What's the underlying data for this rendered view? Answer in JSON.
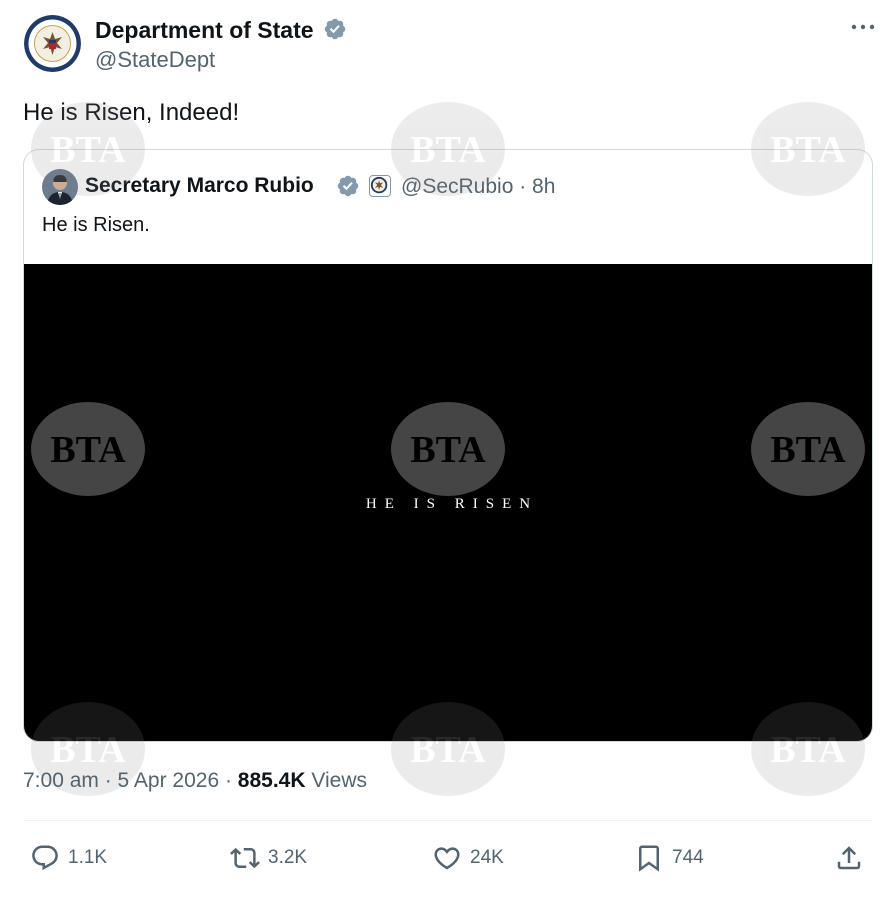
{
  "author": {
    "name": "Department of State",
    "handle": "@StateDept"
  },
  "tweet": {
    "text": "He is Risen, Indeed!"
  },
  "quote": {
    "name": "Secretary Marco Rubio",
    "handle": "@SecRubio · 8h",
    "text": "He is Risen.",
    "media_caption": "HE IS RISEN"
  },
  "meta": {
    "time": "7:00 am · 5 Apr 2026 · ",
    "views_count": "885.4K",
    "views_label": " Views"
  },
  "actions": {
    "replies": "1.1K",
    "reposts": "3.2K",
    "likes": "24K",
    "bookmarks": "744"
  },
  "watermark": {
    "text": "BTA"
  },
  "colors": {
    "verified": "#829aab",
    "text": "#0f1419",
    "secondary": "#536471",
    "border": "#cfd9de"
  },
  "icons": [
    "verified-badge-icon",
    "more-icon",
    "reply-icon",
    "repost-icon",
    "like-icon",
    "bookmark-icon",
    "share-icon",
    "state-department-seal-icon"
  ]
}
